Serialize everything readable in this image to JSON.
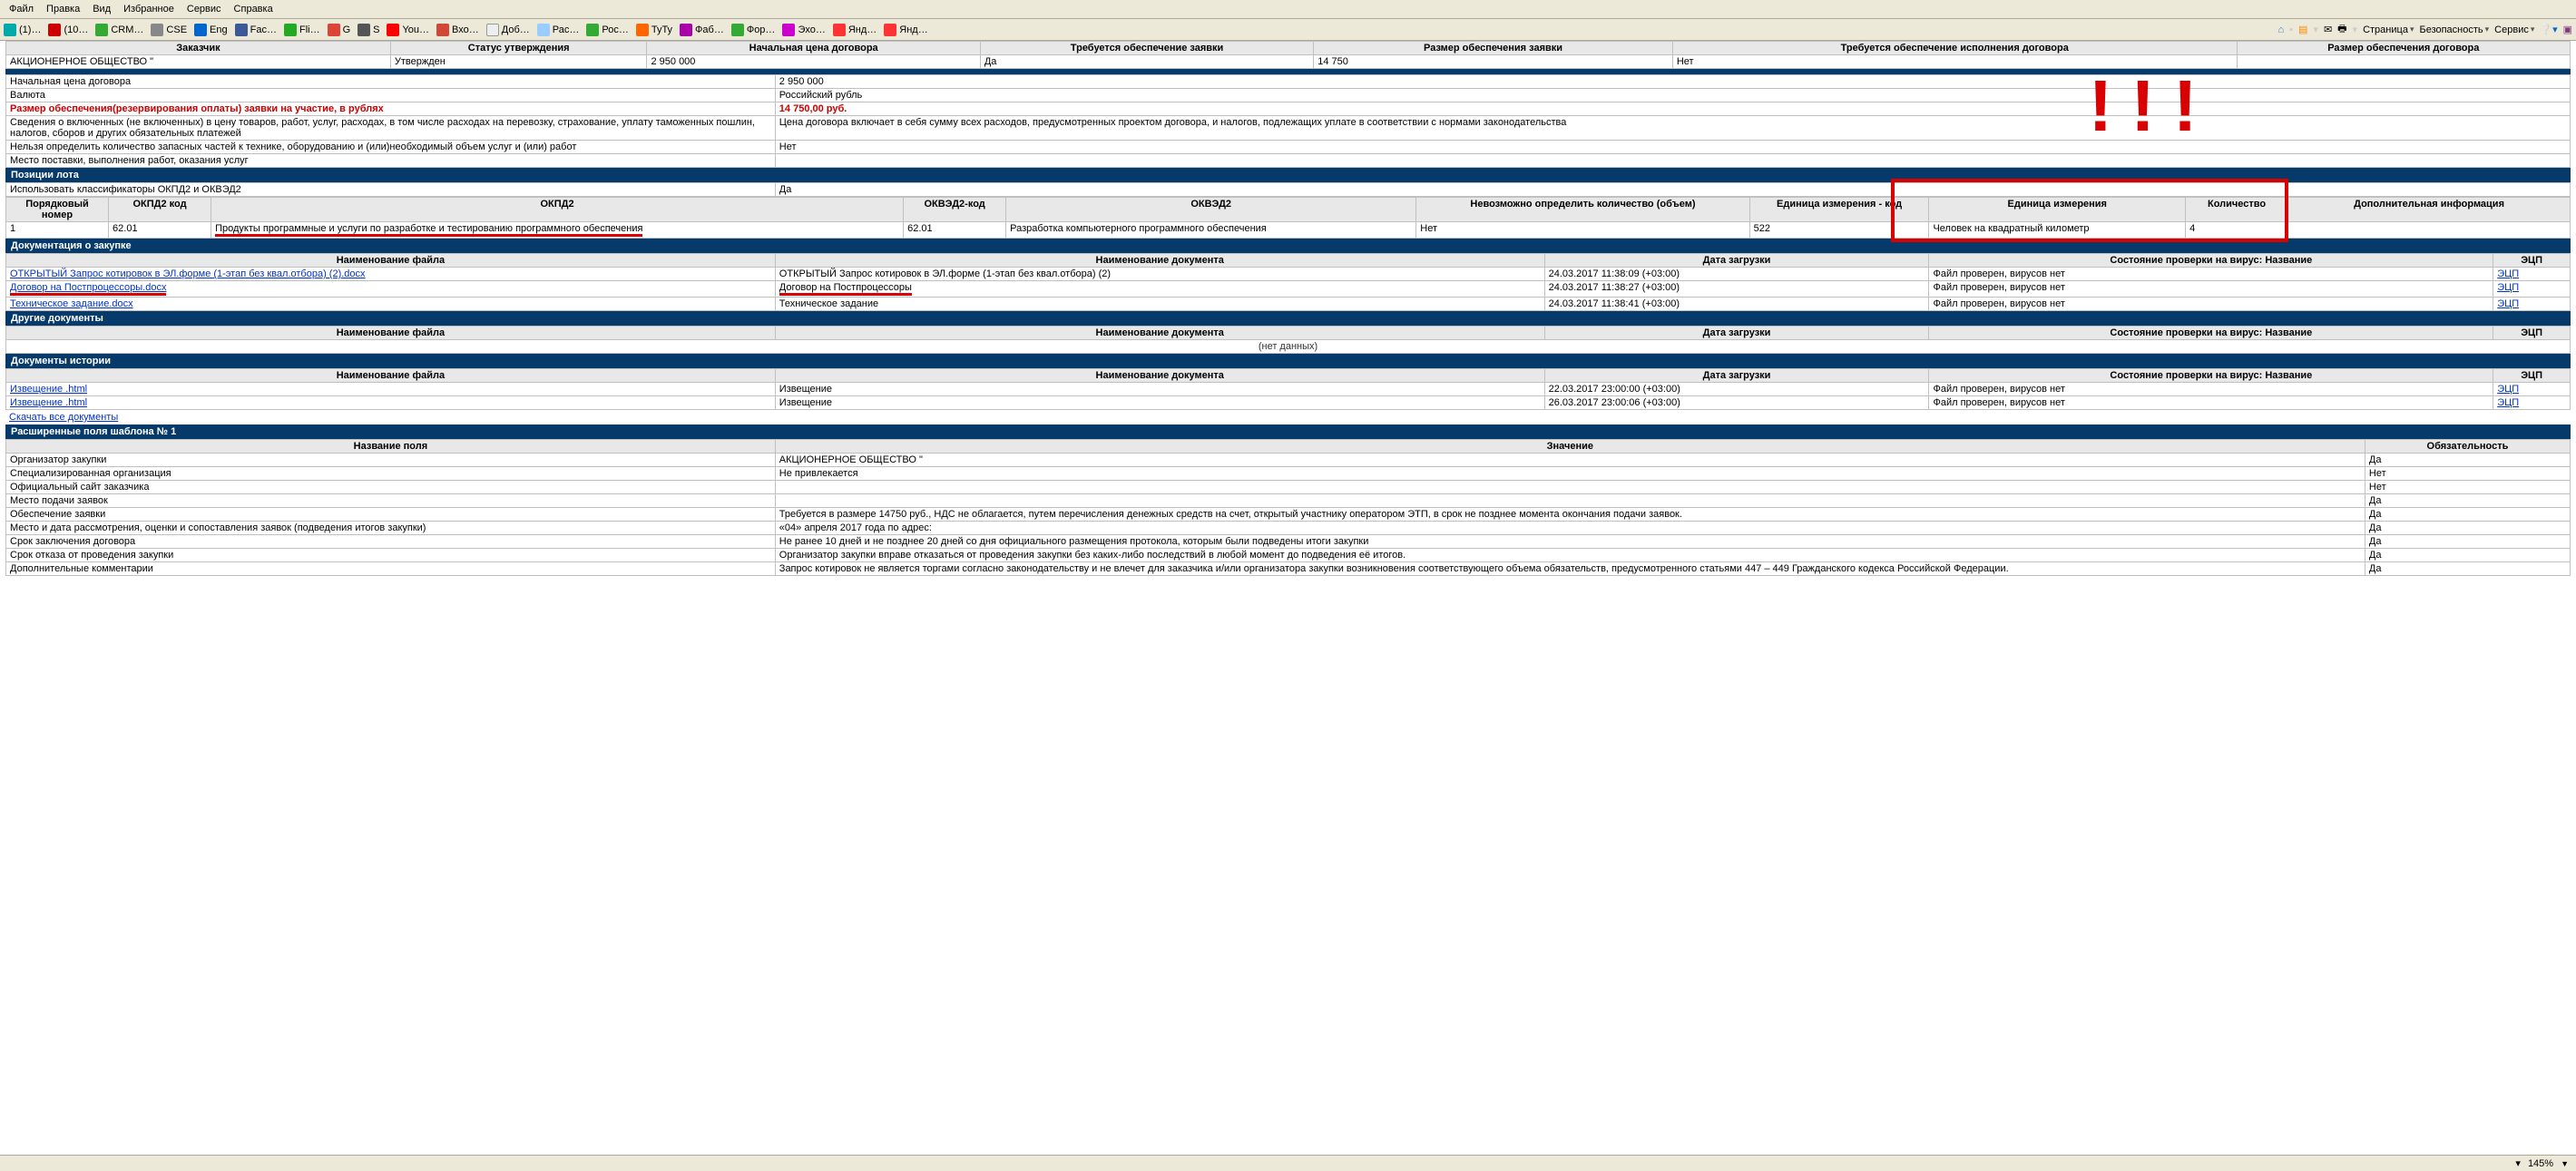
{
  "menubar": {
    "file": "Файл",
    "edit": "Правка",
    "view": "Вид",
    "favorites": "Избранное",
    "service": "Сервис",
    "help": "Справка"
  },
  "favbar": {
    "items": [
      {
        "label": "(1)…",
        "icon_name": "globe-blue"
      },
      {
        "label": "(10…",
        "icon_name": "red-1"
      },
      {
        "label": "CRM…",
        "icon_name": "green-box"
      },
      {
        "label": "CSE",
        "icon_name": "grey-box"
      },
      {
        "label": "Eng",
        "icon_name": "flag"
      },
      {
        "label": "Fac…",
        "icon_name": "fb"
      },
      {
        "label": "Fli…",
        "icon_name": "green-f"
      },
      {
        "label": "G",
        "icon_name": "google"
      },
      {
        "label": "S",
        "icon_name": "grey-s"
      },
      {
        "label": "You…",
        "icon_name": "yt"
      },
      {
        "label": "Вхо…",
        "icon_name": "gmail"
      },
      {
        "label": "Доб…",
        "icon_name": "r2"
      },
      {
        "label": "Рас…",
        "icon_name": "cloud"
      },
      {
        "label": "Рос…",
        "icon_name": "green-box"
      },
      {
        "label": "ТуТу",
        "icon_name": "tutu"
      },
      {
        "label": "Фаб…",
        "icon_name": "fab"
      },
      {
        "label": "Фор…",
        "icon_name": "forum"
      },
      {
        "label": "Эхо…",
        "icon_name": "echo"
      },
      {
        "label": "Янд…",
        "icon_name": "ya"
      },
      {
        "label": "Янд…",
        "icon_name": "ya"
      }
    ],
    "right": {
      "page": "Страница",
      "security": "Безопасность",
      "service": "Сервис"
    }
  },
  "summary_table": {
    "headers": {
      "customer": "Заказчик",
      "status": "Статус утверждения",
      "start_price": "Начальная цена договора",
      "bid_security_required": "Требуется обеспечение заявки",
      "bid_security_amount": "Размер обеспечения заявки",
      "contract_security_required": "Требуется обеспечение исполнения договора",
      "contract_security_amount": "Размер обеспечения договора"
    },
    "row": {
      "customer": "АКЦИОНЕРНОЕ ОБЩЕСТВО \"",
      "status": "Утвержден",
      "start_price": "2 950 000",
      "bid_security_required": "Да",
      "bid_security_amount": "14 750",
      "contract_security_required": "Нет",
      "contract_security_amount": ""
    }
  },
  "details": {
    "rows": [
      {
        "label": "Начальная цена договора",
        "value": "2 950 000",
        "label_class": "",
        "value_class": ""
      },
      {
        "label": "Валюта",
        "value": "Российский рубль",
        "label_class": "",
        "value_class": ""
      },
      {
        "label": "Размер обеспечения(резервирования оплаты) заявки на участие, в рублях",
        "value": "14 750,00 руб.",
        "label_class": "red-bold",
        "value_class": "red-bold-val"
      },
      {
        "label": "Сведения о включенных (не включенных) в цену товаров, работ, услуг, расходах, в том числе расходах на перевозку, страхование, уплату таможенных пошлин, налогов, сборов и других обязательных платежей",
        "value": "Цена договора включает в себя сумму всех расходов, предусмотренных проектом договора, и налогов, подлежащих уплате в соответствии с нормами законодательства",
        "label_class": "",
        "value_class": ""
      },
      {
        "label": "Нельзя определить количество запасных частей к технике, оборудованию и (или)необходимый объем услуг и (или) работ",
        "value": "Нет",
        "label_class": "",
        "value_class": ""
      },
      {
        "label": "Место поставки, выполнения работ, оказания услуг",
        "value": "",
        "label_class": "",
        "value_class": ""
      }
    ]
  },
  "lot_section": {
    "title": "Позиции лота",
    "classifiers_label": "Использовать классификаторы ОКПД2 и ОКВЭД2",
    "classifiers_value": "Да",
    "headers": {
      "ord": "Порядковый номер",
      "okpd2_code": "ОКПД2 код",
      "okpd2": "ОКПД2",
      "okved2_code": "ОКВЭД2-код",
      "okved2": "ОКВЭД2",
      "qty_impossible": "Невозможно определить количество (объем)",
      "unit_code": "Единица измерения - код",
      "unit": "Единица измерения",
      "qty": "Количество",
      "extra": "Дополнительная информация"
    },
    "row": {
      "ord": "1",
      "okpd2_code": "62.01",
      "okpd2": "Продукты программные и услуги по разработке и тестированию программного обеспечения",
      "okved2_code": "62.01",
      "okved2": "Разработка компьютерного программного обеспечения",
      "qty_impossible": "Нет",
      "unit_code": "522",
      "unit": "Человек на квадратный километр",
      "qty": "4",
      "extra": ""
    }
  },
  "docs_section": {
    "title": "Документация о закупке",
    "headers": {
      "filename": "Наименование файла",
      "docname": "Наименование документа",
      "upload_date": "Дата загрузки",
      "virus_state": "Состояние проверки на вирус: Название",
      "ecp": "ЭЦП"
    },
    "rows": [
      {
        "filename": "ОТКРЫТЫЙ Запрос котировок в ЭЛ.форме (1-этап без квал.отбора) (2).docx",
        "docname": "ОТКРЫТЫЙ Запрос котировок в ЭЛ.форме (1-этап без квал.отбора) (2)",
        "upload_date": "24.03.2017 11:38:09 (+03:00)",
        "virus_state": "Файл проверен, вирусов нет",
        "ecp": "ЭЦП"
      },
      {
        "filename": "Договор на Постпроцессоры.docx",
        "docname": "Договор на Постпроцессоры",
        "upload_date": "24.03.2017 11:38:27 (+03:00)",
        "virus_state": "Файл проверен, вирусов нет",
        "ecp": "ЭЦП"
      },
      {
        "filename": "Техническое задание.docx",
        "docname": "Техническое задание",
        "upload_date": "24.03.2017 11:38:41 (+03:00)",
        "virus_state": "Файл проверен, вирусов нет",
        "ecp": "ЭЦП"
      }
    ]
  },
  "other_docs_section": {
    "title": "Другие документы",
    "headers": {
      "filename": "Наименование файла",
      "docname": "Наименование документа",
      "upload_date": "Дата загрузки",
      "virus_state": "Состояние проверки на вирус: Название",
      "ecp": "ЭЦП"
    },
    "no_data": "(нет данных)"
  },
  "history_docs_section": {
    "title": "Документы истории",
    "headers": {
      "filename": "Наименование файла",
      "docname": "Наименование документа",
      "upload_date": "Дата загрузки",
      "virus_state": "Состояние проверки на вирус: Название",
      "ecp": "ЭЦП"
    },
    "rows": [
      {
        "filename": "Извещение .html",
        "docname": "Извещение",
        "upload_date": "22.03.2017 23:00:00 (+03:00)",
        "virus_state": "Файл проверен, вирусов нет",
        "ecp": "ЭЦП"
      },
      {
        "filename": "Извещение .html",
        "docname": "Извещение",
        "upload_date": "26.03.2017 23:00:06 (+03:00)",
        "virus_state": "Файл проверен, вирусов нет",
        "ecp": "ЭЦП"
      }
    ],
    "download_all": "Скачать все документы"
  },
  "ext_fields_section": {
    "title": "Расширенные поля шаблона № 1",
    "headers": {
      "field_name": "Название поля",
      "value": "Значение",
      "required": "Обязательность"
    },
    "rows": [
      {
        "field_name": "Организатор закупки",
        "value": "АКЦИОНЕРНОЕ ОБЩЕСТВО \"",
        "required": "Да"
      },
      {
        "field_name": "Специализированная организация",
        "value": "Не привлекается",
        "required": "Нет"
      },
      {
        "field_name": "Официальный сайт заказчика",
        "value": "",
        "required": "Нет"
      },
      {
        "field_name": "Место подачи заявок",
        "value": "",
        "required": "Да"
      },
      {
        "field_name": "Обеспечение заявки",
        "value": "Требуется в размере 14750 руб., НДС не облагается, путем перечисления денежных средств на счет, открытый участнику оператором ЭТП, в срок не позднее момента окончания подачи заявок.",
        "required": "Да"
      },
      {
        "field_name": "Место и дата рассмотрения, оценки и сопоставления заявок (подведения итогов закупки)",
        "value": "«04» апреля 2017 года по адрес:",
        "required": "Да"
      },
      {
        "field_name": "Срок заключения договора",
        "value": "Не ранее 10 дней и не позднее 20 дней со дня официального размещения протокола, которым были подведены итоги закупки",
        "required": "Да"
      },
      {
        "field_name": "Срок отказа от проведения закупки",
        "value": "Организатор закупки вправе отказаться от проведения закупки без каких-либо последствий в любой момент до подведения её итогов.",
        "required": "Да"
      },
      {
        "field_name": "Дополнительные комментарии",
        "value": "Запрос котировок не является торгами согласно законодательству и не влечет для заказчика и/или организатора закупки возникновения соответствующего объема обязательств, предусмотренного статьями 447 – 449 Гражданского кодекса Российской Федерации.",
        "required": "Да"
      }
    ]
  },
  "status_bar": {
    "zoom": "145%"
  }
}
